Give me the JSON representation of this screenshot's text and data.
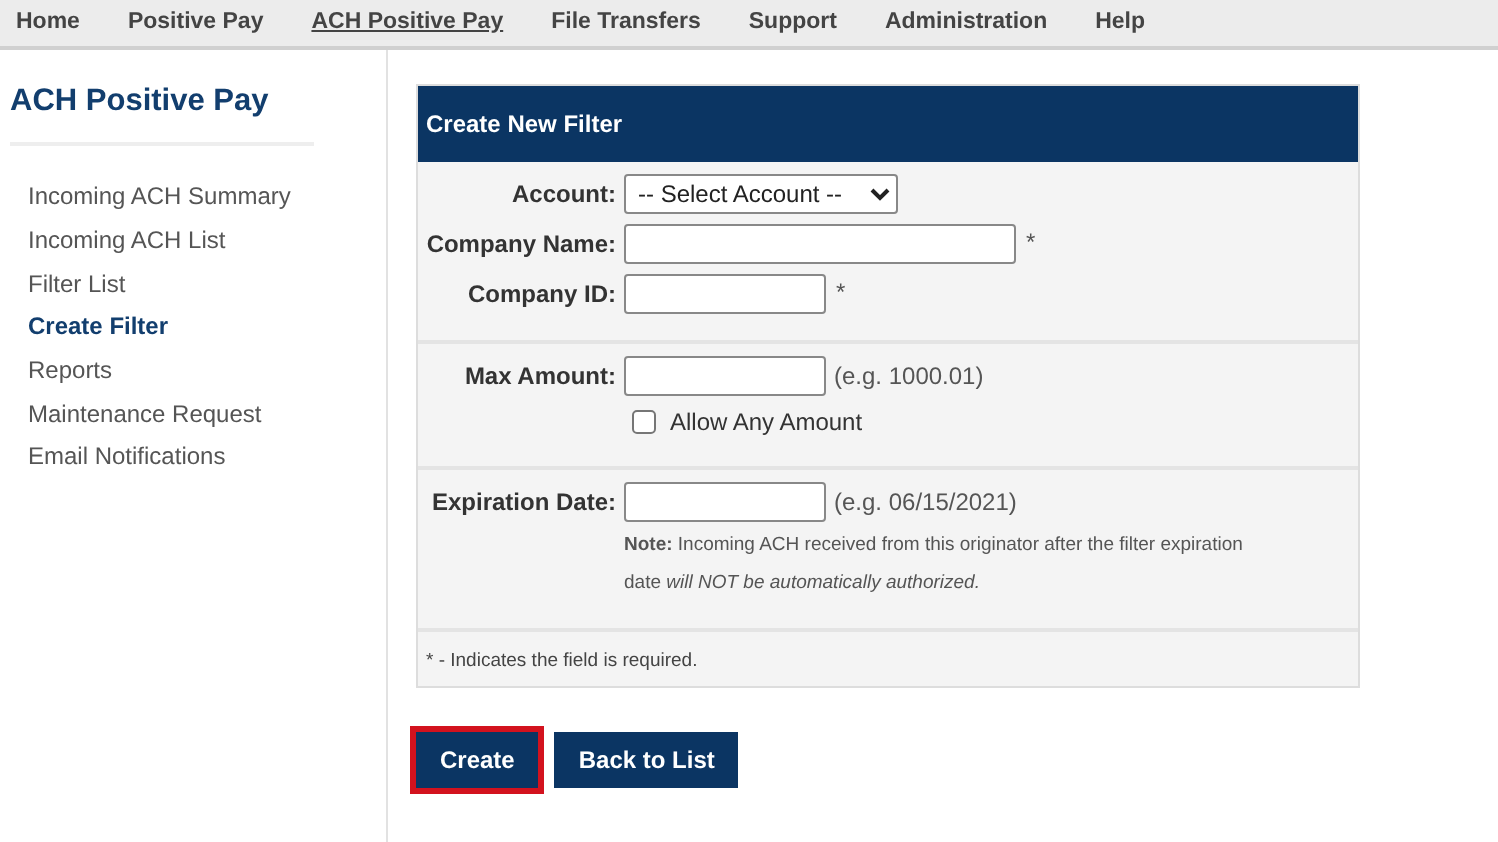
{
  "nav": [
    {
      "label": "Home",
      "selected": false
    },
    {
      "label": "Positive Pay",
      "selected": false
    },
    {
      "label": "ACH Positive Pay",
      "selected": true
    },
    {
      "label": "File Transfers",
      "selected": false
    },
    {
      "label": "Support",
      "selected": false
    },
    {
      "label": "Administration",
      "selected": false
    },
    {
      "label": "Help",
      "selected": false
    }
  ],
  "sidebar": {
    "title": "ACH Positive Pay",
    "items": [
      {
        "label": "Incoming ACH Summary",
        "selected": false
      },
      {
        "label": "Incoming ACH List",
        "selected": false
      },
      {
        "label": "Filter List",
        "selected": false
      },
      {
        "label": "Create Filter",
        "selected": true
      },
      {
        "label": "Reports",
        "selected": false
      },
      {
        "label": "Maintenance Request",
        "selected": false
      },
      {
        "label": "Email Notifications",
        "selected": false
      }
    ]
  },
  "form": {
    "title": "Create New Filter",
    "sections": [
      {
        "fields": [
          {
            "kind": "select",
            "label": "Account:",
            "value": "-- Select Account --"
          },
          {
            "kind": "input",
            "label": "Company Name:",
            "required_mark": "*"
          },
          {
            "kind": "input",
            "label": "Company ID:",
            "required_mark": "*"
          }
        ]
      },
      {
        "fields": [
          {
            "kind": "input",
            "label": "Max Amount:",
            "hint": "(e.g. 1000.01)",
            "checkbox": {
              "label": "Allow Any Amount",
              "checked": false
            }
          }
        ]
      },
      {
        "fields": [
          {
            "kind": "input",
            "label": "Expiration Date:",
            "hint": "(e.g. 06/15/2021)",
            "note": "**Note:** Incoming ACH received from this originator after the filter expiration date *will NOT be automatically authorized.*"
          }
        ]
      }
    ],
    "footnote": "* - Indicates the field is required."
  },
  "buttons": [
    {
      "label": "Create",
      "highlighted": true
    },
    {
      "label": "Back to List",
      "highlighted": false
    }
  ]
}
